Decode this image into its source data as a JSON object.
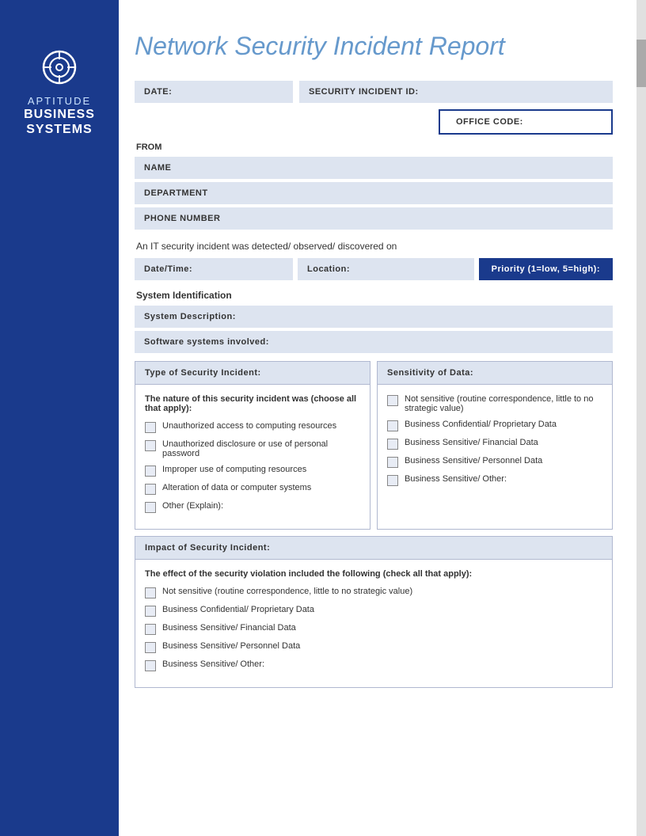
{
  "sidebar": {
    "brand_top": "APTITUDE",
    "brand_main": "BUSINESS\nSYSTEMS",
    "icon_label": "target-icon"
  },
  "header": {
    "title": "Network Security Incident Report"
  },
  "form": {
    "date_label": "DATE:",
    "security_id_label": "SECURITY INCIDENT ID:",
    "office_code_label": "OFFICE CODE:",
    "from_label": "FROM",
    "name_label": "NAME",
    "department_label": "DEPARTMENT",
    "phone_label": "PHONE NUMBER",
    "detection_text": "An IT security incident was detected/ observed/ discovered on",
    "datetime_label": "Date/Time:",
    "location_label": "Location:",
    "priority_label": "Priority (1=low, 5=high):",
    "system_identification_label": "System Identification",
    "system_description_label": "System Description:",
    "software_label": "Software systems involved:",
    "type_header": "Type of Security Incident:",
    "sensitivity_header": "Sensitivity of Data:",
    "nature_subtitle": "The nature of this security incident was (choose all that apply):",
    "type_checkboxes": [
      "Unauthorized access to computing resources",
      "Unauthorized disclosure or use of personal password",
      "Improper use of computing resources",
      "Alteration of data or computer systems",
      "Other (Explain):"
    ],
    "sensitivity_checkboxes": [
      "Not sensitive (routine correspondence, little to no strategic value)",
      "Business Confidential/ Proprietary Data",
      "Business Sensitive/ Financial Data",
      "Business Sensitive/ Personnel Data",
      "Business Sensitive/ Other:"
    ],
    "impact_header": "Impact of Security Incident:",
    "impact_subtitle": "The effect of the security violation included the following (check all that apply):",
    "impact_checkboxes": [
      "Not sensitive (routine correspondence, little to no strategic value)",
      "Business Confidential/ Proprietary Data",
      "Business Sensitive/ Financial Data",
      "Business Sensitive/ Personnel Data",
      "Business Sensitive/ Other:"
    ]
  }
}
